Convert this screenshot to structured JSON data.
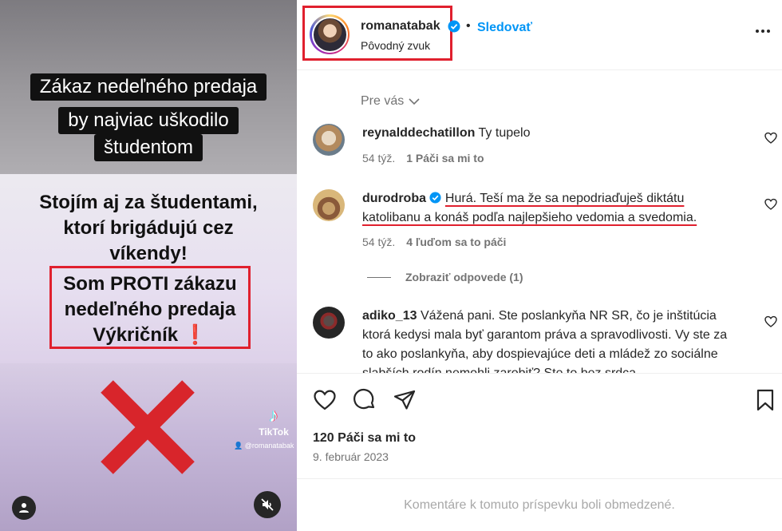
{
  "video": {
    "caption_lines": [
      "Zákaz nedeľného predaja",
      "by najviac uškodilo",
      "študentom"
    ],
    "stance_lines": [
      "Stojím aj za študentami,",
      "ktorí brigádujú cez",
      "víkendy!"
    ],
    "highlight_lines": [
      "Som PROTI zákazu",
      "nedeľného predaja",
      "Výkričník"
    ],
    "highlight_emoji": "❗",
    "tiktok_label": "TikTok",
    "tiktok_handle": "@romanatabak"
  },
  "header": {
    "username": "romanatabak",
    "dot": "•",
    "follow_label": "Sledovať",
    "audio_label": "Pôvodný zvuk"
  },
  "sort": {
    "label": "Pre vás"
  },
  "comments": [
    {
      "username": "reynalddechatillon",
      "text": "Ty tupelo",
      "age": "54 týž.",
      "likes": "1 Páči sa mi to"
    },
    {
      "username": "durodroba",
      "text_line1": "Hurá. Teší ma že sa nepodriaďuješ diktátu",
      "text_line2": "katolibanu a konáš podľa najlepšieho vedomia a svedomia.",
      "age": "54 týž.",
      "likes": "4 ľuďom sa to páči",
      "replies": "Zobraziť odpovede (1)"
    },
    {
      "username": "adiko_13",
      "text": "Vážená pani. Ste poslankyňa NR SR, čo je inštitúcia ktorá kedysi mala byť garantom práva a spravodlivosti. Vy ste za to ako poslankyňa, aby dospievajúce deti a mládež zo sociálne slabších rodín nemohli zarobiť? Ste to bez srdca..."
    }
  ],
  "post": {
    "likes": "120 Páči sa mi to",
    "date": "9. február 2023",
    "comments_limited": "Komentáre k tomuto príspevku boli obmedzené."
  },
  "colors": {
    "link_blue": "#0095f6",
    "highlight_red": "#e0202e",
    "muted": "#737373"
  }
}
